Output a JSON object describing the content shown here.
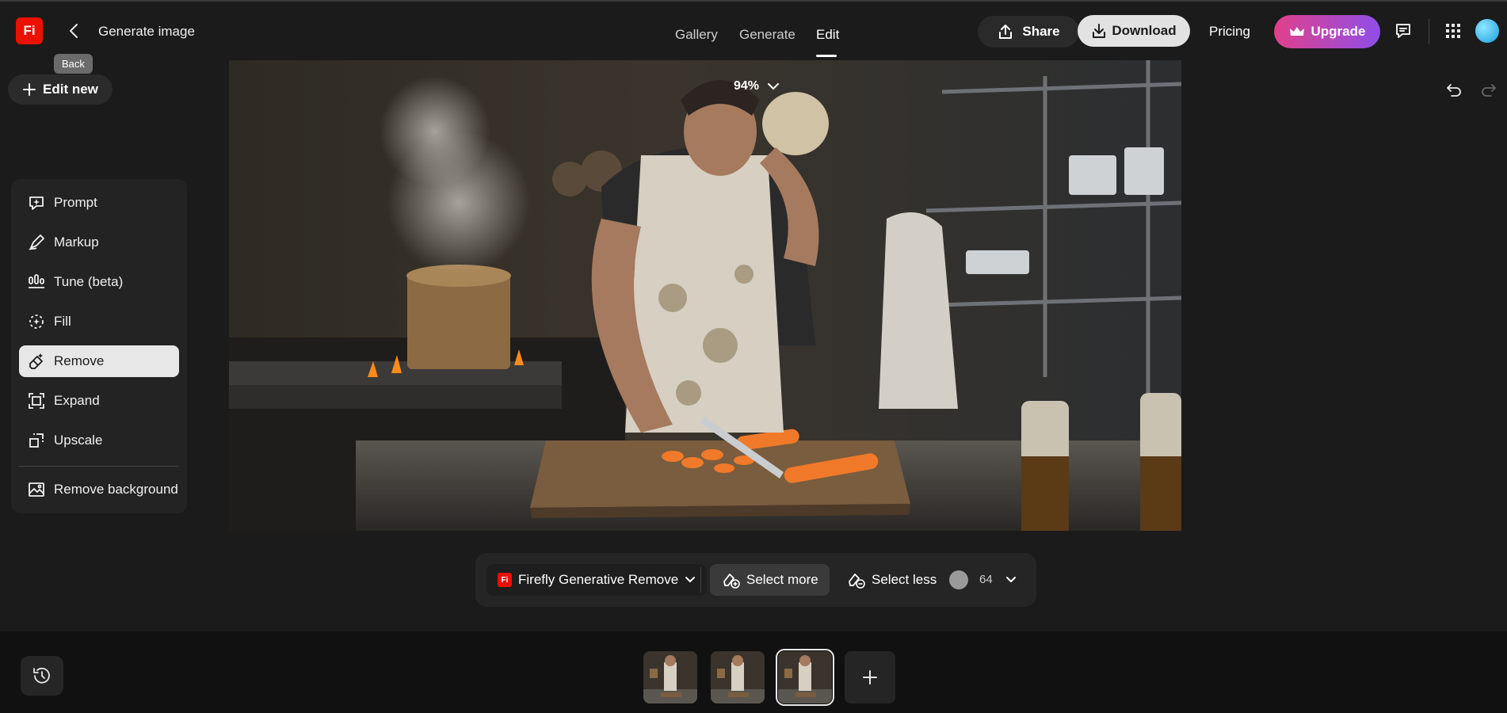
{
  "app": {
    "logo_text": "Fi",
    "title": "Generate image",
    "back_tooltip": "Back"
  },
  "nav": {
    "tabs": [
      {
        "label": "Gallery"
      },
      {
        "label": "Generate"
      },
      {
        "label": "Edit"
      }
    ]
  },
  "header": {
    "share_label": "Share",
    "download_label": "Download",
    "pricing_label": "Pricing",
    "upgrade_label": "Upgrade"
  },
  "sidebar": {
    "edit_new_label": "Edit new",
    "tools": [
      {
        "label": "Prompt",
        "icon": "prompt-icon"
      },
      {
        "label": "Markup",
        "icon": "markup-icon"
      },
      {
        "label": "Tune (beta)",
        "icon": "tune-icon"
      },
      {
        "label": "Fill",
        "icon": "fill-icon"
      },
      {
        "label": "Remove",
        "icon": "remove-icon",
        "active": true
      },
      {
        "label": "Expand",
        "icon": "expand-icon"
      },
      {
        "label": "Upscale",
        "icon": "upscale-icon"
      },
      {
        "label": "Remove background",
        "icon": "remove-background-icon"
      }
    ]
  },
  "canvas": {
    "zoom": "94%"
  },
  "bottom_toolbar": {
    "model_logo": "Fi",
    "model_label": "Firefly Generative Remove",
    "select_more_label": "Select more",
    "select_less_label": "Select less",
    "brush_size": "64"
  },
  "colors": {
    "accent_red": "#eb1000",
    "upgrade_start": "#e0408a",
    "upgrade_end": "#8f4ee8",
    "background": "#1b1b1b"
  }
}
